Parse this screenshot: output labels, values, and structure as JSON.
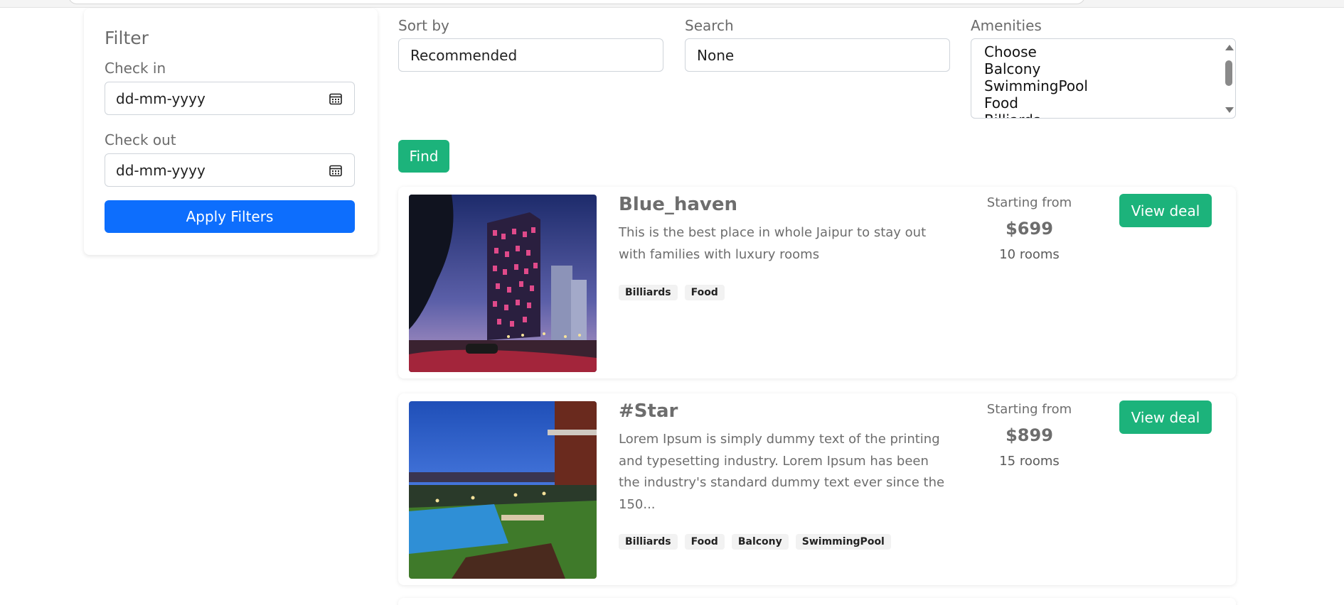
{
  "filter": {
    "title": "Filter",
    "check_in_label": "Check in",
    "check_in_value": "dd-mm-yyyy",
    "check_out_label": "Check out",
    "check_out_value": "dd-mm-yyyy",
    "apply_label": "Apply Filters",
    "calendar_icon": "calendar-icon"
  },
  "controls": {
    "sort_label": "Sort by",
    "sort_value": "Recommended",
    "search_label": "Search",
    "search_value": "None",
    "amenities_label": "Amenities",
    "amenities_options": [
      "Choose",
      "Balcony",
      "SwimmingPool",
      "Food",
      "Billiards"
    ],
    "find_label": "Find"
  },
  "hotels": [
    {
      "name": "Blue_haven",
      "description": "This is the best place in whole Jaipur to stay out with families with luxury rooms",
      "tags": [
        "Billiards",
        "Food"
      ],
      "starting_label": "Starting from",
      "price": "$699",
      "rooms": "10 rooms",
      "deal_label": "View deal"
    },
    {
      "name": "#Star",
      "description": "Lorem Ipsum is simply dummy text of the printing and typesetting industry. Lorem Ipsum has been the industry's standard dummy text ever since the 150...",
      "tags": [
        "Billiards",
        "Food",
        "Balcony",
        "SwimmingPool"
      ],
      "starting_label": "Starting from",
      "price": "$899",
      "rooms": "15 rooms",
      "deal_label": "View deal"
    }
  ],
  "colors": {
    "primary_blue": "#0d6efd",
    "accent_green": "#1cb37b"
  }
}
